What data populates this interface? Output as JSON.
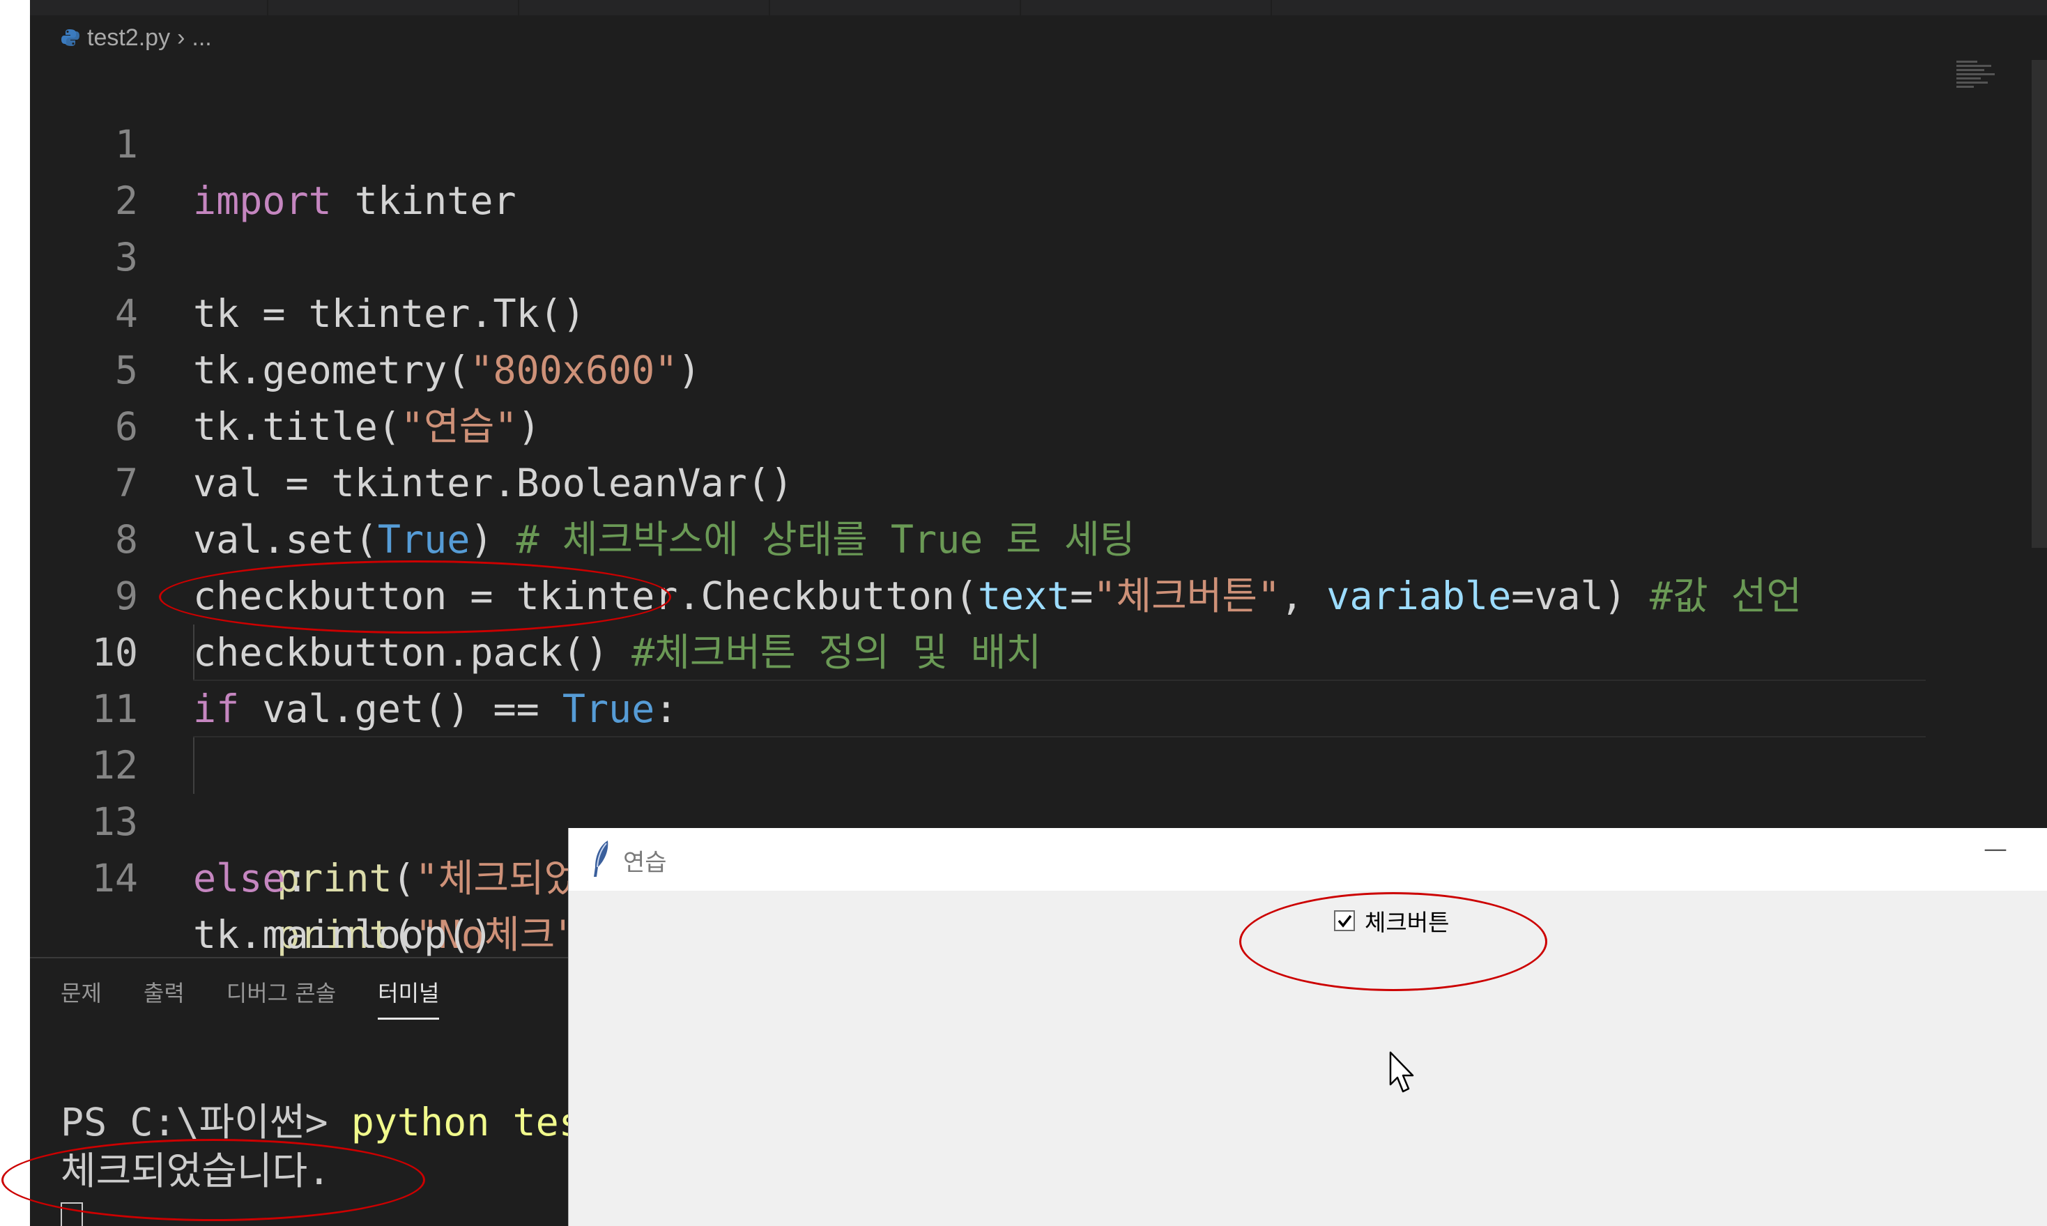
{
  "editor": {
    "breadcrumb": {
      "file": "test2.py",
      "separator": "›",
      "rest": "..."
    },
    "lines": [
      {
        "n": "1"
      },
      {
        "n": "2"
      },
      {
        "n": "3"
      },
      {
        "n": "4"
      },
      {
        "n": "5"
      },
      {
        "n": "6"
      },
      {
        "n": "7"
      },
      {
        "n": "8"
      },
      {
        "n": "9"
      },
      {
        "n": "10"
      },
      {
        "n": "11"
      },
      {
        "n": "12"
      },
      {
        "n": "13"
      },
      {
        "n": "14"
      }
    ],
    "code": {
      "l1_kw": "import",
      "l1_rest": " tkinter",
      "l3": "tk = tkinter.Tk()",
      "l4_a": "tk.geometry(",
      "l4_str": "\"800x600\"",
      "l4_b": ")",
      "l5_a": "tk.title(",
      "l5_str": "\"연습\"",
      "l5_b": ")",
      "l6": "val = tkinter.BooleanVar()",
      "l7_a": "val.set(",
      "l7_true": "True",
      "l7_b": ") ",
      "l7_cmt": "# 체크박스에 상태를 True 로 세팅",
      "l8_a": "checkbutton = tkinter.Checkbutton(",
      "l8_p1": "text",
      "l8_eq": "=",
      "l8_str": "\"체크버튼\"",
      "l8_c": ", ",
      "l8_p2": "variable",
      "l8_d": "=val) ",
      "l8_cmt": "#값 선언",
      "l9_a": "checkbutton.pack() ",
      "l9_cmt": "#체크버튼 정의 및 배치",
      "l10_kw": "if",
      "l10_a": " val.get() == ",
      "l10_true": "True",
      "l10_b": ":",
      "l11_fn": "print",
      "l11_a": "(",
      "l11_str": "\"체크되었습니다.\"",
      "l11_b": ")",
      "l12_kw": "else",
      "l12_b": ":",
      "l13_fn": "print",
      "l13_a": "(",
      "l13_str": "\"No체크\"",
      "l13_b": ")",
      "l14": "tk.mainloop()"
    },
    "active_line": 10
  },
  "panel": {
    "tabs": [
      "문제",
      "출력",
      "디버그 콘솔",
      "터미널"
    ],
    "active_tab": "터미널"
  },
  "terminal": {
    "prompt": "PS C:\\파이썬> ",
    "command": "python tes",
    "output": "체크되었습니다."
  },
  "tk_window": {
    "title": "연습",
    "minimize": "—",
    "checkbox_label": "체크버튼",
    "checked": true
  },
  "colors": {
    "editor_bg": "#1e1e1e",
    "keyword": "#c586c0",
    "string": "#ce9178",
    "constant": "#569cd6",
    "comment": "#6a9955",
    "annotation": "#cc0000"
  }
}
